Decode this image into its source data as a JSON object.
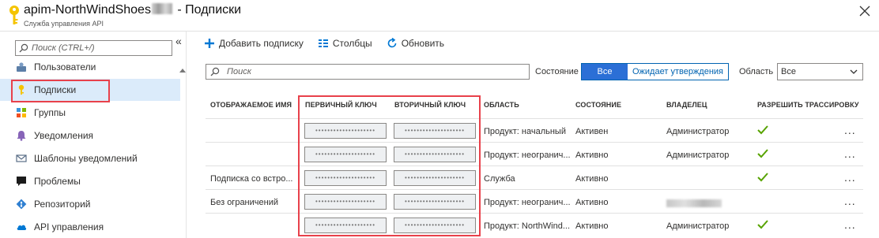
{
  "header": {
    "title_prefix": "apim-NorthWindShoes",
    "title_suffix": " - Подписки",
    "subtitle": "Служба управления API"
  },
  "sidebar": {
    "search_placeholder": "Поиск (CTRL+/)",
    "collapse": "«",
    "items": [
      {
        "label": "Пользователи",
        "icon": "users-icon"
      },
      {
        "label": "Подписки",
        "icon": "key-icon",
        "active": true
      },
      {
        "label": "Группы",
        "icon": "groups-icon"
      },
      {
        "label": "Уведомления",
        "icon": "bell-icon"
      },
      {
        "label": "Шаблоны уведомлений",
        "icon": "mail-icon"
      },
      {
        "label": "Проблемы",
        "icon": "comment-icon"
      },
      {
        "label": "Репозиторий",
        "icon": "git-icon"
      },
      {
        "label": "API управления",
        "icon": "cloud-icon"
      }
    ]
  },
  "toolbar": {
    "add_label": "Добавить подписку",
    "columns_label": "Столбцы",
    "refresh_label": "Обновить"
  },
  "filters": {
    "search_placeholder": "Поиск",
    "state_label": "Состояние",
    "state_all": "Все",
    "state_pending": "Ожидает утверждения",
    "area_label": "Область",
    "area_value": "Все"
  },
  "table": {
    "columns": [
      "ОТОБРАЖАЕМОЕ ИМЯ",
      "ПЕРВИЧНЫЙ КЛЮЧ",
      "ВТОРИЧНЫЙ КЛЮЧ",
      "ОБЛАСТЬ",
      "СОСТОЯНИЕ",
      "ВЛАДЕЛЕЦ",
      "РАЗРЕШИТЬ ТРАССИРОВКУ"
    ],
    "key_mask": "••••••••••••••••••••",
    "rows": [
      {
        "name": "",
        "scope": "Продукт: начальный",
        "state": "Активен",
        "owner": "Администратор",
        "trace": true
      },
      {
        "name": "",
        "scope": "Продукт: неогранич...",
        "state": "Активно",
        "owner": "Администратор",
        "trace": true
      },
      {
        "name": "Подписка со встро...",
        "scope": "Служба",
        "state": "Активно",
        "owner": "",
        "trace": true
      },
      {
        "name": "Без ограничений",
        "scope": "Продукт: неогранич...",
        "state": "Активно",
        "owner": "",
        "trace": false
      },
      {
        "name": "",
        "scope": "Продукт: NorthWind...",
        "state": "Активно",
        "owner": "Администратор",
        "trace": true
      }
    ],
    "more": "..."
  },
  "colors": {
    "accent": "#0078d4",
    "highlight": "#e8414b",
    "check": "#57a300",
    "selected_bg": "#dbebfa"
  }
}
